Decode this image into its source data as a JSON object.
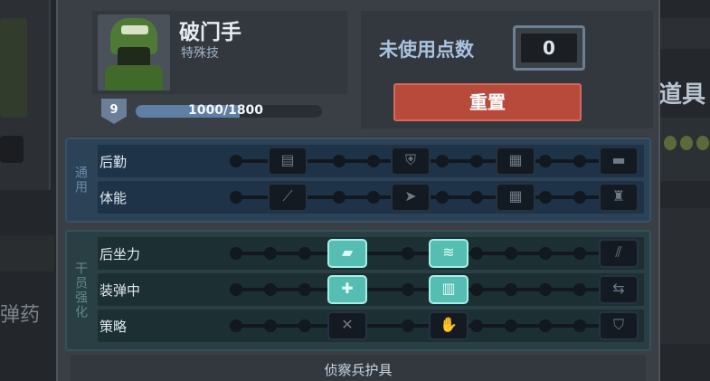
{
  "unit": {
    "name": "破门手",
    "class": "特殊技",
    "level": "9",
    "xp_text": "1000/1800",
    "xp_fraction": 0.556
  },
  "points": {
    "label": "未使用点数",
    "value": "0",
    "reset_label": "重置"
  },
  "sections": {
    "general": {
      "tag": "通用",
      "rows": [
        {
          "label": "后勤",
          "perk_icons": [
            "ammo-belt-icon",
            "armor-plus-icon",
            "supply-crate-icon",
            "bunk-icon"
          ]
        },
        {
          "label": "体能",
          "perk_icons": [
            "knife-icon",
            "speed-arrow-icon",
            "grid-icon",
            "stamina-icon"
          ]
        }
      ]
    },
    "specialist": {
      "tag": "干员强化",
      "rows": [
        {
          "label": "后坐力",
          "perk_icons": [
            "recoil-grip-icon",
            "recoil-stabilizer-icon",
            "tally-marks-icon"
          ],
          "active": [
            true,
            true,
            false
          ]
        },
        {
          "label": "装弹中",
          "perk_icons": [
            "reload-plus-icon",
            "magazine-icon",
            "quick-reload-icon"
          ],
          "active": [
            true,
            true,
            false
          ]
        },
        {
          "label": "策略",
          "perk_icons": [
            "tools-icon",
            "hand-icon",
            "shield-icon"
          ],
          "active": [
            false,
            false,
            false
          ]
        }
      ]
    }
  },
  "footer": {
    "text": "侦察兵护具"
  },
  "background": {
    "left_label": "弹药",
    "right_label": "道具"
  },
  "colors": {
    "accent_teal": "#56bdb2",
    "reset_red": "#b84a3c",
    "xp_blue": "#5e7ea3"
  }
}
